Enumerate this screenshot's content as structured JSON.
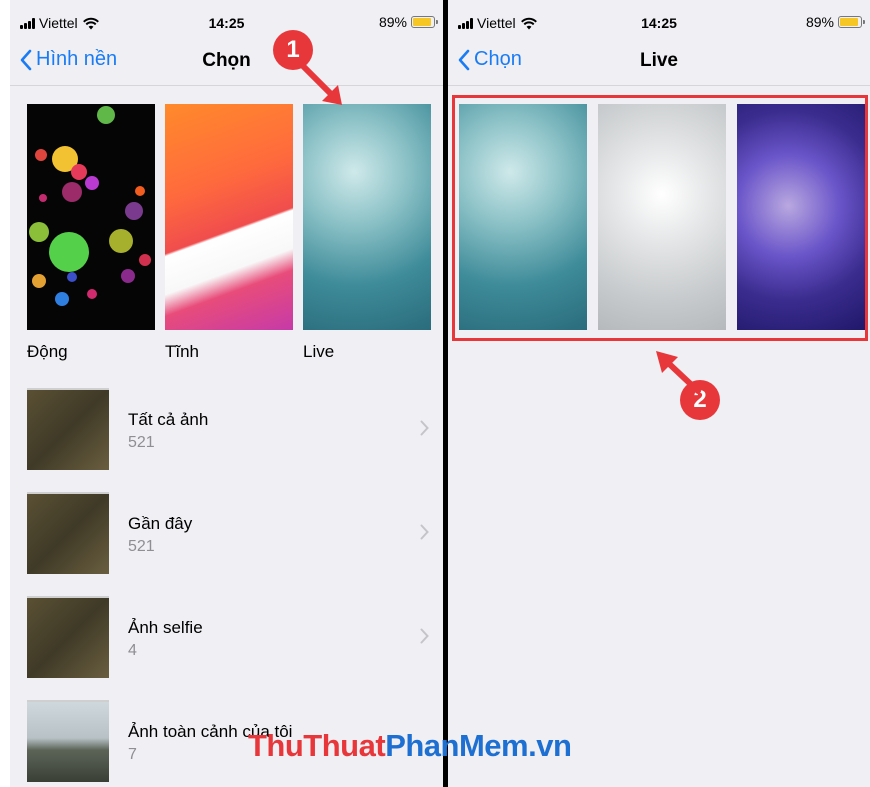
{
  "status_bar": {
    "carrier": "Viettel",
    "time": "14:25",
    "battery": "89%"
  },
  "left_screen": {
    "back_label": "Hình nền",
    "title": "Chọn",
    "wallpaper_types": [
      "Động",
      "Tĩnh",
      "Live"
    ],
    "albums": [
      {
        "name": "Tất cả ảnh",
        "count": "521"
      },
      {
        "name": "Gần đây",
        "count": "521"
      },
      {
        "name": "Ảnh selfie",
        "count": "4"
      },
      {
        "name": "Ảnh toàn cảnh của tôi",
        "count": "7"
      }
    ]
  },
  "right_screen": {
    "back_label": "Chọn",
    "title": "Live"
  },
  "annotations": {
    "marker_1": "1",
    "marker_2": "2"
  },
  "watermark": {
    "part1": "ThuThuat",
    "part2": "PhanMem",
    "part3": ".vn"
  },
  "colors": {
    "ios_blue": "#1a7cf5",
    "highlight_red": "#e8373b",
    "battery_yellow": "#f6c624"
  }
}
